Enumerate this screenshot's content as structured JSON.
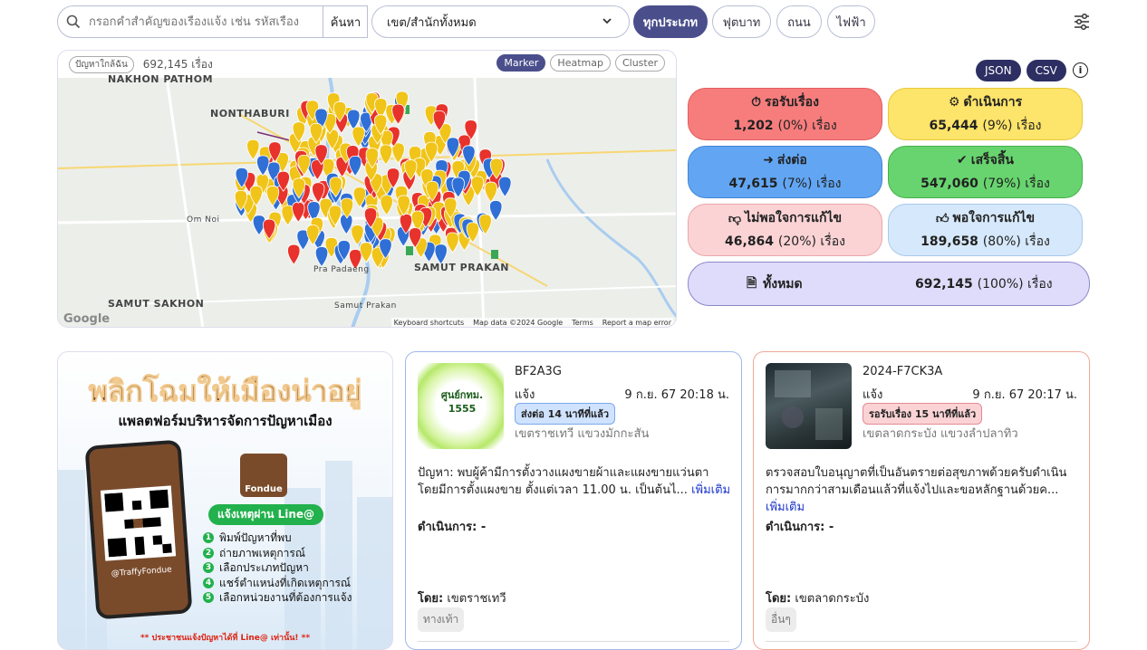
{
  "topbar": {
    "search_placeholder": "กรอกคำสำคัญของเรื่องแจ้ง เช่น รหัสเรื่อง",
    "search_button": "ค้นหา",
    "district_select": "เขต/สำนักทั้งหมด",
    "filters": [
      "ทุกประเภท",
      "ฟุตบาท",
      "ถนน",
      "ไฟฟ้า"
    ],
    "active_filter": "ทุกประเภท"
  },
  "map": {
    "tag": "ปัญหาใกล้ฉัน",
    "count": "692,145 เรื่อง",
    "modes": [
      "Marker",
      "Heatmap",
      "Cluster"
    ],
    "active_mode": "Marker",
    "labels": [
      "NONTHABURI",
      "SAMUT PRAKAN",
      "SAMUT SAKHON",
      "NAKHON PATHOM",
      "Om Noi",
      "Pra Padaeng",
      "Samut Prakan"
    ],
    "footer": [
      "Keyboard shortcuts",
      "Map data ©2024 Google",
      "Terms",
      "Report a map error"
    ],
    "google": "Google"
  },
  "export": {
    "json": "JSON",
    "csv": "CSV",
    "info": "i"
  },
  "stats": [
    {
      "title": "รอรับเรื่อง",
      "count": "1,202",
      "pct": "(0%) เรื่อง",
      "bg": "#f77d7d",
      "border": "#e35b5b"
    },
    {
      "title": "ดำเนินการ",
      "count": "65,444",
      "pct": "(9%) เรื่อง",
      "bg": "#fde46a",
      "border": "#e9c83c"
    },
    {
      "title": "ส่งต่อ",
      "count": "47,615",
      "pct": "(7%) เรื่อง",
      "bg": "#62a6f3",
      "border": "#3f86d8"
    },
    {
      "title": "เสร็จสิ้น",
      "count": "547,060",
      "pct": "(79%) เรื่อง",
      "bg": "#68d46f",
      "border": "#41b34a"
    },
    {
      "title": "ไม่พอใจการแก้ไข",
      "count": "46,864",
      "pct": "(20%) เรื่อง",
      "bg": "#fbd3d5",
      "border": "#eba5aa"
    },
    {
      "title": "พอใจการแก้ไข",
      "count": "189,658",
      "pct": "(80%) เรื่อง",
      "bg": "#d6e8fb",
      "border": "#a8c8ec"
    }
  ],
  "total": {
    "title": "ทั้งหมด",
    "count": "692,145",
    "pct": "(100%) เรื่อง"
  },
  "promo": {
    "headline": "พลิกโฉมให้เมืองน่าอยู่",
    "subtitle": "แพลตฟอร์มบริหารจัดการปัญหาเมือง",
    "brand": "Fondue",
    "handle": "@TraffyFondue",
    "line_badge": "แจ้งเหตุผ่าน Line@",
    "steps": [
      "พิมพ์ปัญหาที่พบ",
      "ถ่ายภาพเหตุการณ์",
      "เลือกประเภทปัญหา",
      "แชร์ตำแหน่งที่เกิดเหตุการณ์",
      "เลือกหน่วยงานที่ต้องการแจ้ง"
    ],
    "note": "** ประชาชนแจ้งปัญหาได้ที่ Line@ เท่านั้น! **"
  },
  "cards": [
    {
      "id": "BF2A3G",
      "kind": "แจ้ง",
      "date": "9 ก.ย. 67 20:18 น.",
      "badge": "ส่งต่อ 14 นาทีที่แล้ว",
      "location": "เขตราชเทวี แขวงมักกะสัน",
      "desc": "ปัญหา: พบผู้ค้ามีการตั้งวางแผงขายผ้าและแผงขายแว่นตา โดยมีการตั้งแผงขาย ตั้งแต่เวลา 11.00 น. เป็นต้นไ...",
      "more": "เพิ่มเติม",
      "action": "ดำเนินการ: -",
      "by_label": "โดย:",
      "by": "เขตราชเทวี",
      "tag": "ทางเท้า",
      "thumb_text": "ศูนย์กทม. 1555",
      "border": "#9fb7ea",
      "badge_bg": "#cfe3ff",
      "badge_border": "#7aa8ea"
    },
    {
      "id": "2024-F7CK3A",
      "kind": "แจ้ง",
      "date": "9 ก.ย. 67 20:17 น.",
      "badge": "รอรับเรื่อง 15 นาทีที่แล้ว",
      "location": "เขตลาดกระบัง แขวงลำปลาทิว",
      "desc": "ตรวจสอบใบอนุญาตที่เป็นอันตรายต่อสุขภาพด้วยครับดำเนินการมากกว่าสามเดือนแล้วที่แจ้งไปและขอหลักฐานด้วยค...",
      "more": "เพิ่มเติม",
      "action": "ดำเนินการ: -",
      "by_label": "โดย:",
      "by": "เขตลาดกระบัง",
      "tag": "อื่นๆ",
      "border": "#f0a898",
      "badge_bg": "#fbd3d5",
      "badge_border": "#e38b92"
    }
  ]
}
